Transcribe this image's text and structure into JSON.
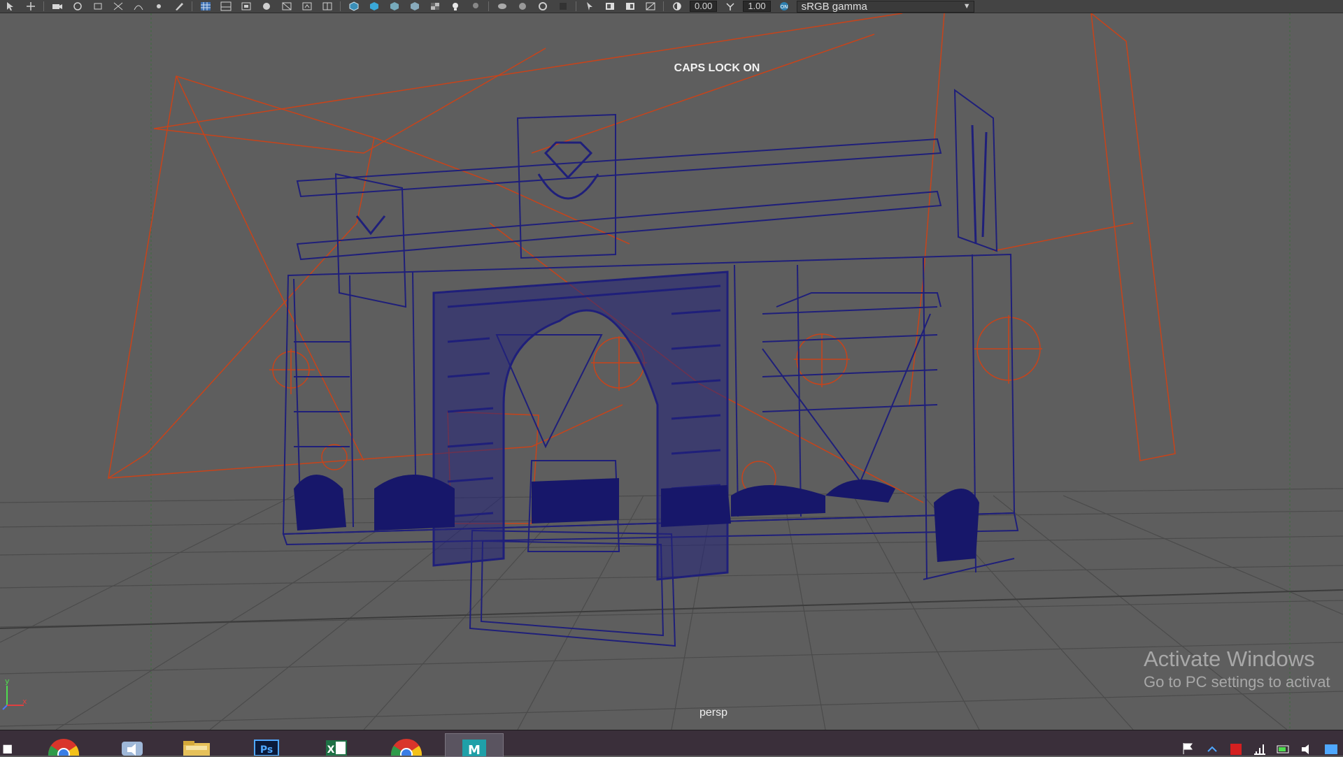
{
  "toolbar": {
    "field_exposure": "0.00",
    "field_gamma": "1.00",
    "color_management_badge": "ON",
    "color_space_select": "sRGB gamma",
    "icons": [
      "select-icon",
      "move-icon",
      "rotate-icon",
      "scale-icon",
      "snap-grid-icon",
      "snap-curve-icon",
      "snap-point-icon",
      "camera-icon",
      "grid-icon",
      "wireframe-icon",
      "shaded-icon",
      "textured-icon",
      "lights-icon",
      "shadows-icon",
      "isolate-icon",
      "xray-icon",
      "resolution-gate-icon",
      "exposure-icon",
      "gamma-icon",
      "color-management-icon"
    ]
  },
  "viewport": {
    "caps_lock_notice": "CAPS LOCK ON",
    "camera_name": "persp",
    "axis_x": "x",
    "axis_y": "y",
    "wire_color": "#1f1f7a",
    "light_color": "#c8431a",
    "grid_color": "#4a4a4a",
    "background": "#5e5e5e"
  },
  "watermark": {
    "title": "Activate Windows",
    "subtitle": "Go to PC settings to activat"
  },
  "taskbar": {
    "apps": [
      {
        "name": "chrome",
        "icon": "chrome-icon"
      },
      {
        "name": "media-player",
        "icon": "speaker-icon"
      },
      {
        "name": "file-explorer",
        "icon": "folder-icon"
      },
      {
        "name": "photoshop",
        "icon": "photoshop-icon",
        "label": "Ps"
      },
      {
        "name": "excel",
        "icon": "excel-icon",
        "label": "X"
      },
      {
        "name": "chrome-2",
        "icon": "chrome-icon"
      },
      {
        "name": "maya",
        "icon": "maya-icon",
        "label": "M"
      }
    ]
  }
}
